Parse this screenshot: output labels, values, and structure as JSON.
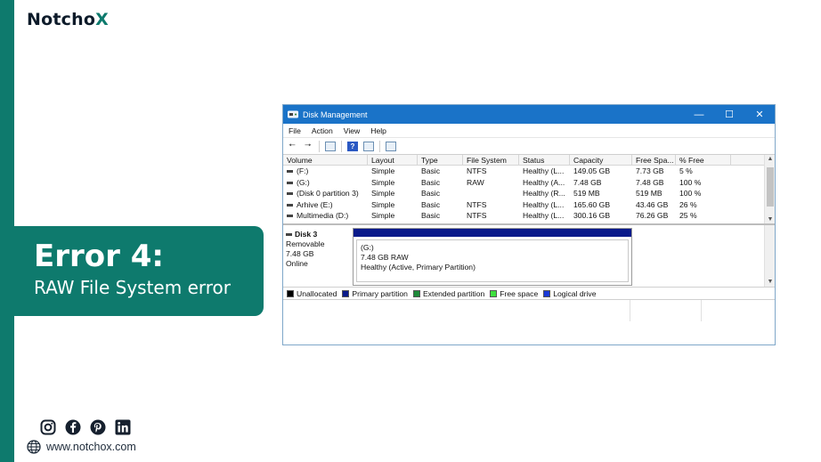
{
  "brand": {
    "logo_prefix": "Notch",
    "logo_mark": "o",
    "logo_suffix": "X",
    "accent_color": "#0e7a6d"
  },
  "error_card": {
    "title": "Error 4:",
    "subtitle": "RAW File System error"
  },
  "social": {
    "icons": [
      "instagram-icon",
      "facebook-icon",
      "pinterest-icon",
      "linkedin-icon"
    ],
    "website": "www.notchox.com"
  },
  "window": {
    "title": "Disk Management",
    "controls": {
      "minimize": "—",
      "maximize": "☐",
      "close": "✕"
    },
    "menu": [
      "File",
      "Action",
      "View",
      "Help"
    ],
    "columns": [
      "Volume",
      "Layout",
      "Type",
      "File System",
      "Status",
      "Capacity",
      "Free Spa...",
      "% Free"
    ],
    "rows": [
      [
        "(F:)",
        "Simple",
        "Basic",
        "NTFS",
        "Healthy (L...",
        "149.05 GB",
        "7.73 GB",
        "5 %"
      ],
      [
        "(G:)",
        "Simple",
        "Basic",
        "RAW",
        "Healthy (A...",
        "7.48 GB",
        "7.48 GB",
        "100 %"
      ],
      [
        "(Disk 0 partition 3)",
        "Simple",
        "Basic",
        "",
        "Healthy (R...",
        "519 MB",
        "519 MB",
        "100 %"
      ],
      [
        "Arhive (E:)",
        "Simple",
        "Basic",
        "NTFS",
        "Healthy (L...",
        "165.60 GB",
        "43.46 GB",
        "26 %"
      ],
      [
        "Multimedia (D:)",
        "Simple",
        "Basic",
        "NTFS",
        "Healthy (L...",
        "300.16 GB",
        "76.26 GB",
        "25 %"
      ]
    ],
    "highlighted_row": 1,
    "disk": {
      "name": "Disk 3",
      "kind": "Removable",
      "size": "7.48 GB",
      "state": "Online",
      "partition": {
        "label": "(G:)",
        "size_fs": "7.48 GB RAW",
        "status": "Healthy (Active, Primary Partition)"
      }
    },
    "legend": [
      {
        "label": "Unallocated",
        "color": "#000000"
      },
      {
        "label": "Primary partition",
        "color": "#0a1a8a"
      },
      {
        "label": "Extended partition",
        "color": "#1e8a3a"
      },
      {
        "label": "Free space",
        "color": "#3ee03e"
      },
      {
        "label": "Logical drive",
        "color": "#1a3ad8"
      }
    ]
  }
}
